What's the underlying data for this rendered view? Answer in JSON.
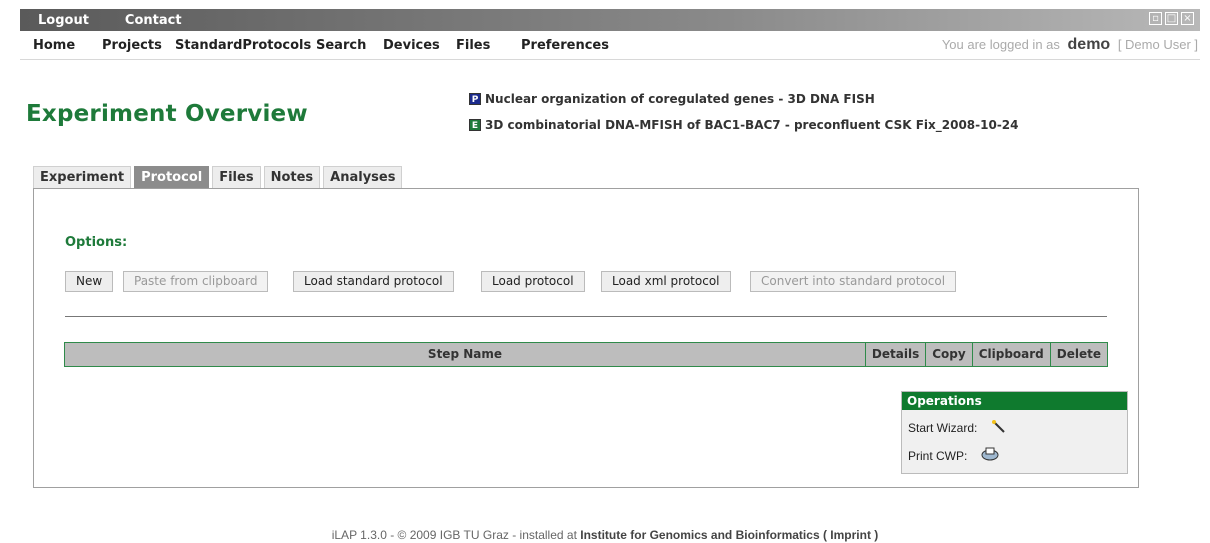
{
  "topbar": {
    "logout": "Logout",
    "contact": "Contact"
  },
  "nav": {
    "items": [
      "Home",
      "Projects",
      "StandardProtocols",
      "Search",
      "Devices",
      "Files",
      "Preferences"
    ],
    "login_prefix": "You are logged in as",
    "username": "demo",
    "fullname": "[ Demo User ]"
  },
  "page": {
    "title": "Experiment Overview",
    "project": {
      "badge": "P",
      "label": "Nuclear organization of coregulated genes - 3D DNA FISH",
      "color": "#1b2a8c"
    },
    "experiment": {
      "badge": "E",
      "label": "3D combinatorial DNA-MFISH of BAC1-BAC7 - preconfluent CSK Fix_2008-10-24",
      "color": "#1e7a3a"
    }
  },
  "tabs": [
    {
      "label": "Experiment",
      "active": false
    },
    {
      "label": "Protocol",
      "active": true
    },
    {
      "label": "Files",
      "active": false
    },
    {
      "label": "Notes",
      "active": false
    },
    {
      "label": "Analyses",
      "active": false
    }
  ],
  "options": {
    "label": "Options:",
    "buttons": [
      {
        "label": "New",
        "disabled": false
      },
      {
        "label": "Paste from clipboard",
        "disabled": true
      },
      {
        "label": "Load standard protocol",
        "disabled": false
      },
      {
        "label": "Load protocol",
        "disabled": false
      },
      {
        "label": "Load xml protocol",
        "disabled": false
      },
      {
        "label": "Convert into standard protocol",
        "disabled": true
      }
    ]
  },
  "steps_table": {
    "columns": [
      "Step Name",
      "Details",
      "Copy",
      "Clipboard",
      "Delete"
    ]
  },
  "operations": {
    "header": "Operations",
    "start_wizard": "Start Wizard:",
    "print_cwp": "Print CWP:"
  },
  "footer": {
    "prefix": "iLAP 1.3.0 - © 2009 IGB TU Graz - installed at",
    "institute": "Institute for Genomics and Bioinformatics ( Imprint )"
  },
  "colors": {
    "accent_green": "#1e7a3a",
    "operations_header": "#0f7a2e"
  }
}
